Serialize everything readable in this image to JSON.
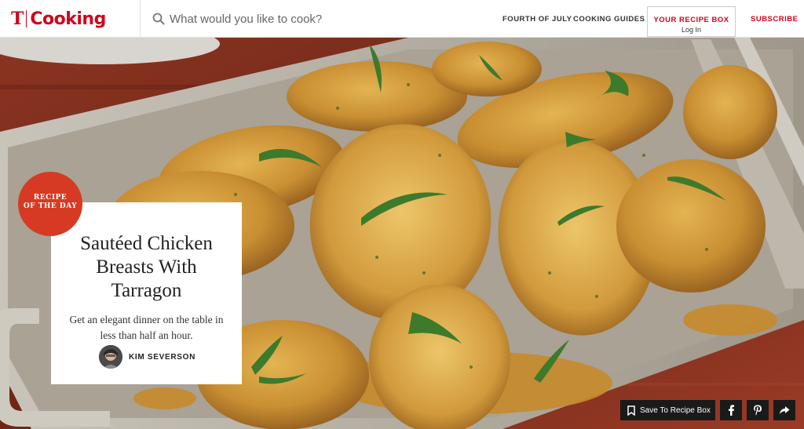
{
  "header": {
    "logo_mark": "T",
    "logo_word": "Cooking",
    "search_placeholder": "What would you like to cook?",
    "nav": [
      "FOURTH OF JULY",
      "COOKING GUIDES"
    ],
    "recipe_box": {
      "title": "YOUR RECIPE BOX",
      "login": "Log In"
    },
    "subscribe": "SUBSCRIBE"
  },
  "feature": {
    "badge": [
      "RECIPE",
      "OF THE DAY"
    ],
    "title": "Sautéed Chicken Breasts With Tarragon",
    "description": "Get an elegant dinner on the table in less than half an hour.",
    "author": "KIM SEVERSON"
  },
  "actions": {
    "save_label": "Save To Recipe Box",
    "icons": [
      "bookmark-icon",
      "facebook-icon",
      "pinterest-icon",
      "share-icon"
    ]
  },
  "colors": {
    "brand_red": "#d0021b",
    "badge_red": "#d63a24",
    "button_dark": "#1a1a1a"
  }
}
